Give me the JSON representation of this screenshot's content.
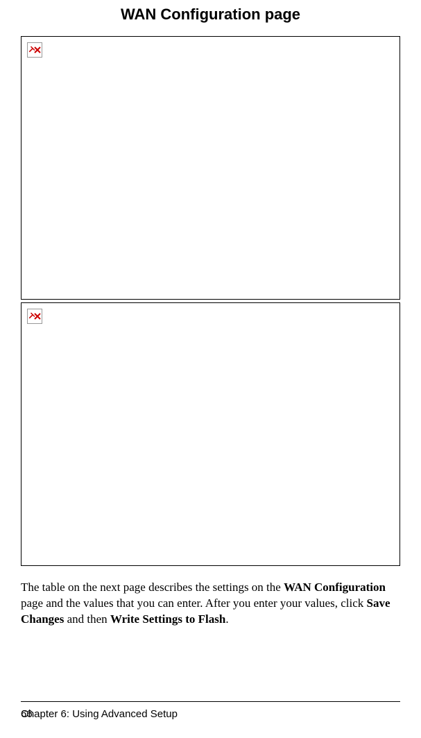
{
  "title": "WAN Configuration page",
  "images": {
    "top_alt": "broken-image-icon",
    "bottom_alt": "broken-image-icon"
  },
  "paragraph": {
    "part1": "The table on the next page describes the settings on the ",
    "bold1": "WAN Configuration",
    "part2": " page and the values that you can enter. After you enter your values, click ",
    "bold2": "Save Changes",
    "part3": " and then ",
    "bold3": "Write Settings to Flash",
    "part4": "."
  },
  "footer": {
    "page_number": "66",
    "chapter": "Chapter 6: Using Advanced Setup"
  }
}
